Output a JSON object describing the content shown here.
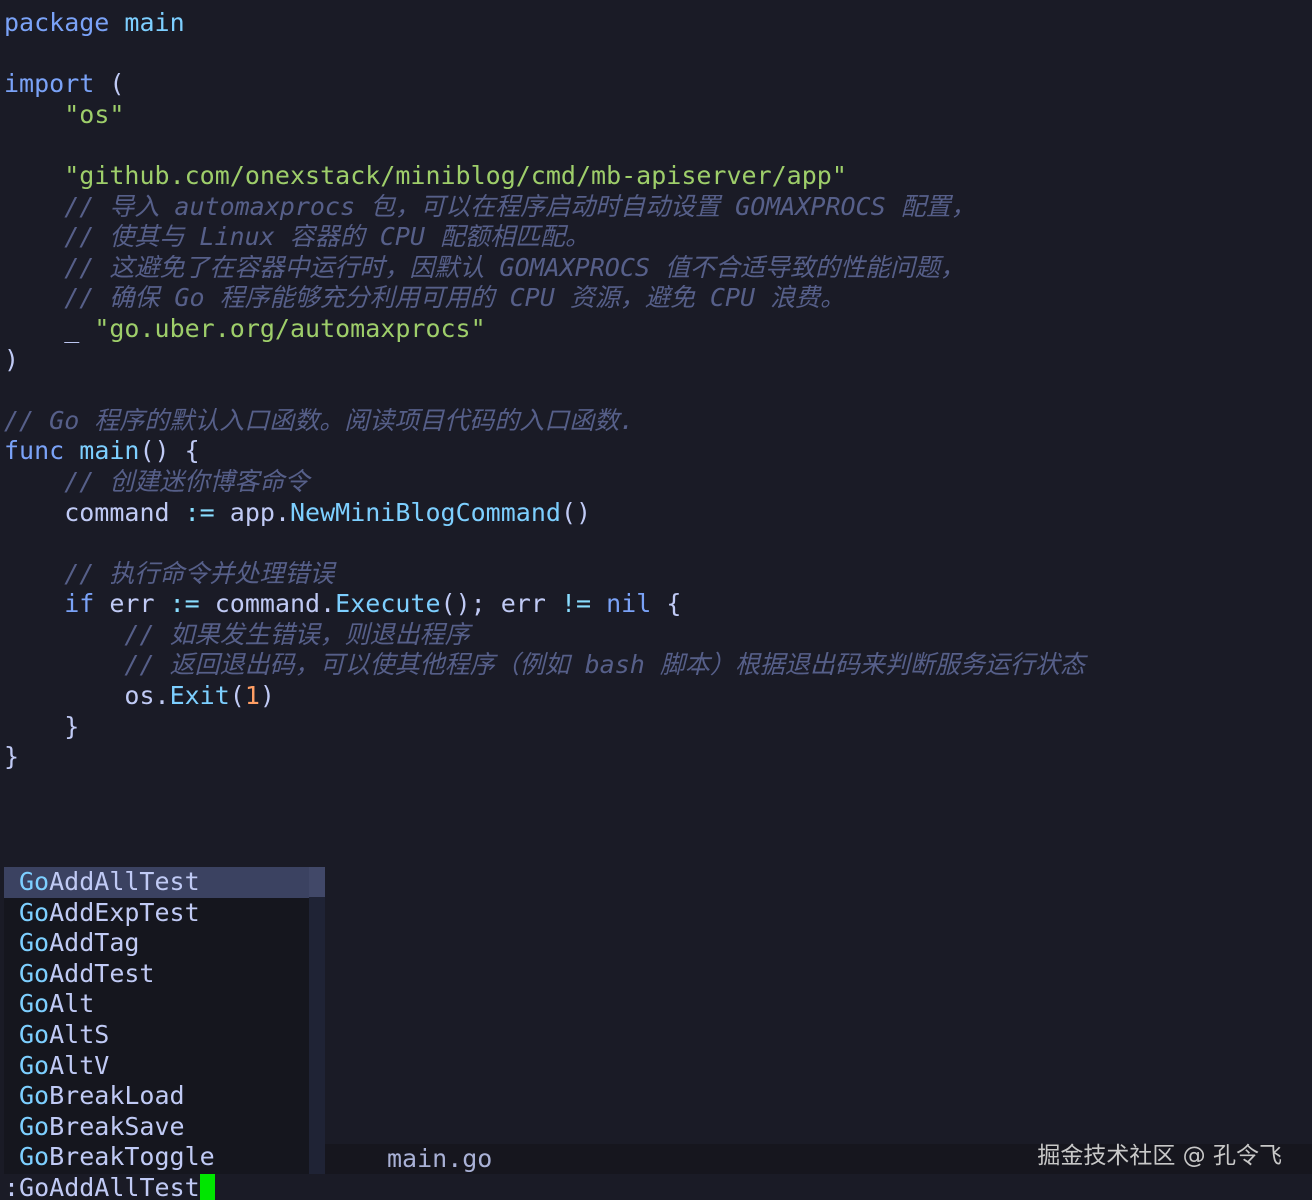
{
  "code": {
    "l1": {
      "a": "package",
      "b": " ",
      "c": "main"
    },
    "l3": {
      "a": "import",
      "b": " ("
    },
    "l4": {
      "a": "    ",
      "b": "\"os\""
    },
    "l6": {
      "a": "    ",
      "b": "\"github.com/onexstack/miniblog/cmd/mb-apiserver/app\""
    },
    "l7": {
      "a": "    ",
      "b": "// 导入 automaxprocs 包，可以在程序启动时自动设置 GOMAXPROCS 配置，"
    },
    "l8": {
      "a": "    ",
      "b": "// 使其与 Linux 容器的 CPU 配额相匹配。"
    },
    "l9": {
      "a": "    ",
      "b": "// 这避免了在容器中运行时，因默认 GOMAXPROCS 值不合适导致的性能问题，"
    },
    "l10": {
      "a": "    ",
      "b": "// 确保 Go 程序能够充分利用可用的 CPU 资源，避免 CPU 浪费。"
    },
    "l11": {
      "a": "    _ ",
      "b": "\"go.uber.org/automaxprocs\""
    },
    "l12": {
      "a": ")"
    },
    "l14": {
      "a": "// Go 程序的默认入口函数。阅读项目代码的入口函数."
    },
    "l15": {
      "a": "func",
      "b": " ",
      "c": "main",
      "d": "() {"
    },
    "l16": {
      "a": "    ",
      "b": "// 创建迷你博客命令"
    },
    "l17": {
      "a": "    command ",
      "b": ":=",
      "c": " app.",
      "d": "NewMiniBlogCommand",
      "e": "()"
    },
    "l19": {
      "a": "    ",
      "b": "// 执行命令并处理错误"
    },
    "l20": {
      "a": "    ",
      "b": "if",
      "c": " err ",
      "d": ":=",
      "e": " command.",
      "f": "Execute",
      "g": "(); err ",
      "h": "!=",
      "i": " ",
      "j": "nil",
      "k": " {"
    },
    "l21": {
      "a": "        ",
      "b": "// 如果发生错误，则退出程序"
    },
    "l22": {
      "a": "        ",
      "b": "// 返回退出码，可以使其他程序（例如 bash 脚本）根据退出码来判断服务运行状态"
    },
    "l23": {
      "a": "        os.",
      "b": "Exit",
      "c": "(",
      "d": "1",
      "e": ")"
    },
    "l24": {
      "a": "    }"
    },
    "l25": {
      "a": "}"
    }
  },
  "completion": {
    "prefix": "Go",
    "items": [
      {
        "rest": "AddAllTest",
        "selected": true
      },
      {
        "rest": "AddExpTest"
      },
      {
        "rest": "AddTag"
      },
      {
        "rest": "AddTest"
      },
      {
        "rest": "Alt"
      },
      {
        "rest": "AltS"
      },
      {
        "rest": "AltV"
      },
      {
        "rest": "BreakLoad"
      },
      {
        "rest": "BreakSave"
      },
      {
        "rest": "BreakToggle"
      }
    ]
  },
  "statusline": {
    "filename": "main.go",
    "watermark": "掘金技术社区 @ 孔令飞"
  },
  "cmdline": {
    "text": ":GoAddAllTest"
  },
  "colors": {
    "background": "#1a1b26",
    "keyword": "#7aa2f7",
    "function": "#7dcfff",
    "string": "#9ece6a",
    "number": "#ff9e64",
    "comment": "#565f89",
    "cursor": "#00e600",
    "selection": "#3b4261"
  }
}
